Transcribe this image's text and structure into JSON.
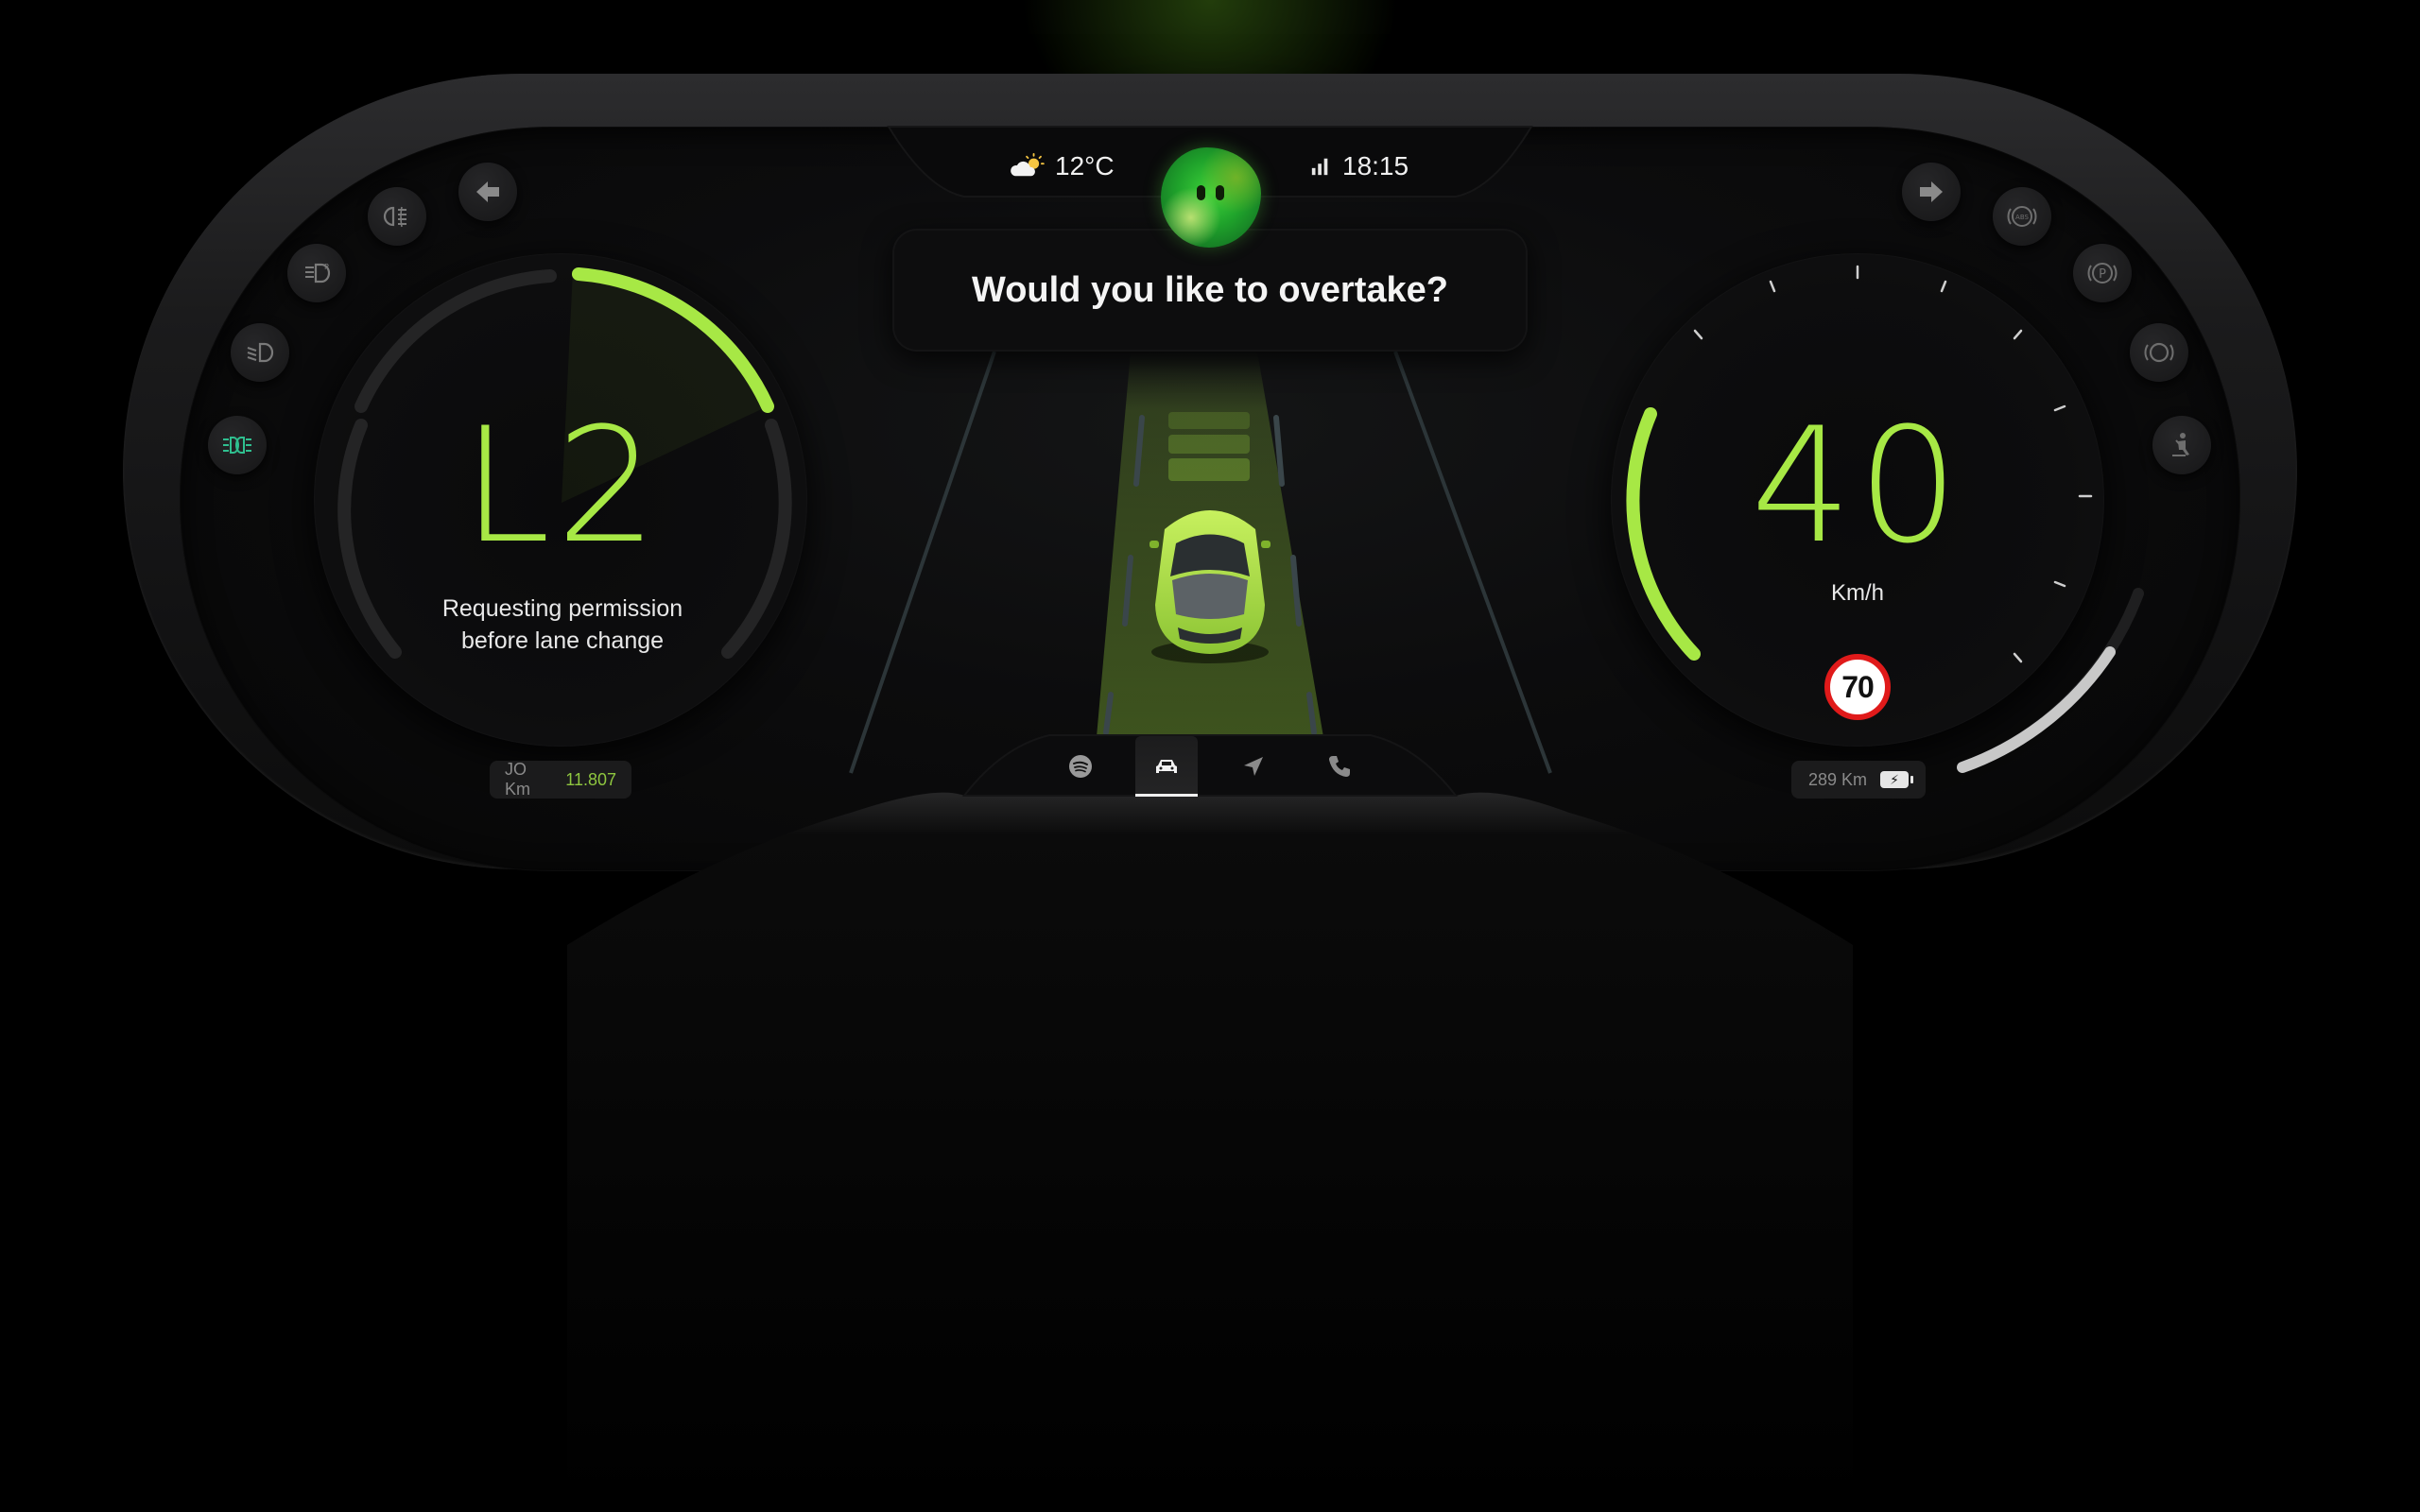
{
  "status_bar": {
    "temperature": "12°C",
    "time": "18:15",
    "weather_icon": "partly-cloudy-icon",
    "signal_icon": "signal-icon"
  },
  "assistant": {
    "prompt": "Would you like to overtake?",
    "avatar_icon": "assistant-blob-avatar"
  },
  "autonomy": {
    "level": "L2",
    "caption_line1": "Requesting permission",
    "caption_line2": "before lane change"
  },
  "speedometer": {
    "speed": "40",
    "unit": "Km/h",
    "speed_limit": "70"
  },
  "odometer": {
    "label": "JO Km",
    "value": "11.807"
  },
  "range": {
    "label": "289 Km",
    "battery_icon": "battery-charging-icon"
  },
  "left_indicators": [
    "fog-light-icon",
    "parking-light-icon",
    "low-beam-icon",
    "side-light-icon"
  ],
  "right_indicators": [
    "abs-icon",
    "parking-brake-icon",
    "brake-warning-icon",
    "seatbelt-icon"
  ],
  "dock": {
    "items": [
      "spotify-icon",
      "car-icon",
      "navigation-icon",
      "phone-icon"
    ],
    "active": "car-icon"
  },
  "colors": {
    "accent": "#a7e845",
    "limit_ring": "#e01a1a",
    "indicator_active": "#2fbf8f"
  }
}
